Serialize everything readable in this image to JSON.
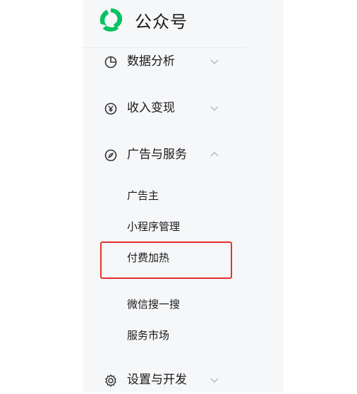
{
  "brand": {
    "title": "公众号",
    "accent_color": "#07c160",
    "logo_icon": "wechat-official-accounts-logo"
  },
  "menu": [
    {
      "key": "data-analysis",
      "label": "数据分析",
      "icon": "pie-chart-icon",
      "expanded": false
    },
    {
      "key": "revenue",
      "label": "收入变现",
      "icon": "yen-circle-icon",
      "expanded": false
    },
    {
      "key": "ads-services",
      "label": "广告与服务",
      "icon": "compass-icon",
      "expanded": true,
      "children": [
        {
          "key": "advertiser",
          "label": "广告主"
        },
        {
          "key": "mini-program",
          "label": "小程序管理"
        },
        {
          "key": "paid-boost",
          "label": "付费加热",
          "highlighted": true
        },
        {
          "key": "wechat-search",
          "label": "微信搜一搜"
        },
        {
          "key": "service-market",
          "label": "服务市场"
        }
      ]
    },
    {
      "key": "settings-dev",
      "label": "设置与开发",
      "icon": "gear-icon",
      "expanded": false
    }
  ],
  "highlight_color": "#e5322d"
}
